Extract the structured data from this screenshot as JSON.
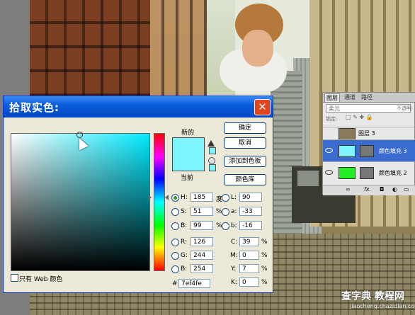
{
  "photo": {
    "watermark_main": "查字典 教程网",
    "watermark_sub": "jiaocheng.chazidian.com"
  },
  "picker": {
    "title": "拾取实色:",
    "label_new": "新的",
    "label_current": "当前",
    "new_color": "#7ef4fe",
    "current_color": "#7ef4fe",
    "buttons": {
      "ok": "确定",
      "cancel": "取消",
      "add_to_swatches": "添加到色板",
      "color_libraries": "颜色库"
    },
    "hsb": [
      {
        "label": "H:",
        "value": "185",
        "unit": "度",
        "selected": true
      },
      {
        "label": "S:",
        "value": "51",
        "unit": "%",
        "selected": false
      },
      {
        "label": "B:",
        "value": "99",
        "unit": "%",
        "selected": false
      }
    ],
    "rgb": [
      {
        "label": "R:",
        "value": "126"
      },
      {
        "label": "G:",
        "value": "244"
      },
      {
        "label": "B:",
        "value": "254"
      }
    ],
    "lab": [
      {
        "label": "L:",
        "value": "90"
      },
      {
        "label": "a:",
        "value": "-33"
      },
      {
        "label": "b:",
        "value": "-16"
      }
    ],
    "cmyk": [
      {
        "label": "C:",
        "value": "39",
        "unit": "%"
      },
      {
        "label": "M:",
        "value": "0",
        "unit": "%"
      },
      {
        "label": "Y:",
        "value": "7",
        "unit": "%"
      },
      {
        "label": "K:",
        "value": "0",
        "unit": "%"
      }
    ],
    "hex_label": "#",
    "hex_value": "7ef4fe",
    "web_only_label": "只有 Web 颜色"
  },
  "layers_panel": {
    "tabs": [
      "图层",
      "通道",
      "路径"
    ],
    "blend_mode": "柔光",
    "opacity_label": "不透明",
    "lock_label": "锁定:",
    "layers": [
      {
        "name": "图层 3",
        "thumb_color": "#8a7a5a"
      },
      {
        "name": "颜色填充 3",
        "thumb_color": "#7ef4fe"
      },
      {
        "name": "颜色填充 2",
        "thumb_color": "#22ee22"
      }
    ],
    "footer_icons": [
      "link-icon",
      "fx-icon",
      "mask-icon",
      "adjustment-icon",
      "folder-icon",
      "new-layer-icon",
      "trash-icon"
    ]
  }
}
